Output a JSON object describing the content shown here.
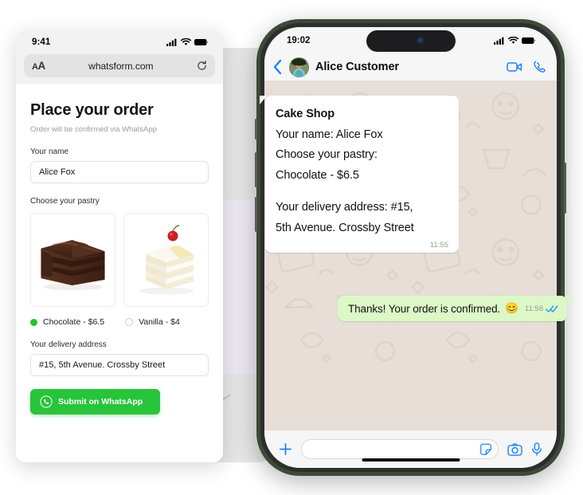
{
  "browser": {
    "status": {
      "time": "9:41",
      "icons": [
        "signal-icon",
        "wifi-icon",
        "battery-icon"
      ]
    },
    "url_bar": {
      "aa_label": "AA",
      "url": "whatsform.com",
      "reload_icon": "reload-icon"
    },
    "form": {
      "title": "Place your order",
      "subtitle": "Order will be confirmed via WhatsApp",
      "name_label": "Your name",
      "name_value": "Alice Fox",
      "name_placeholder": "Your name",
      "pastry_label": "Choose your pastry",
      "pastry_options": [
        {
          "image": "chocolate-cake-image",
          "label": "Chocolate - $6.5",
          "selected": true
        },
        {
          "image": "vanilla-cake-image",
          "label": "Vanilla - $4",
          "selected": false
        }
      ],
      "address_label": "Your delivery address",
      "address_value": "#15, 5th Avenue. Crossby Street",
      "address_placeholder": "Your delivery address",
      "submit_label": "Submit on WhatsApp",
      "submit_icon": "whatsapp-icon",
      "submit_color": "#28c43a"
    }
  },
  "phone": {
    "status": {
      "time": "19:02",
      "icons": [
        "signal-icon",
        "wifi-icon",
        "battery-icon"
      ]
    },
    "header": {
      "back_icon": "back-chevron-icon",
      "avatar": "contact-avatar",
      "contact_name": "Alice Customer",
      "video_icon": "video-call-icon",
      "call_icon": "phone-call-icon"
    },
    "messages": {
      "incoming": {
        "lines": [
          "Cake Shop",
          "Your name: Alice Fox",
          "Choose your pastry:",
          "Chocolate - $6.5",
          "Your delivery address: #15,",
          "5th Avenue. Crossby Street"
        ],
        "time": "11:55"
      },
      "outgoing": {
        "text": "Thanks! Your order is confirmed.",
        "emoji": "😊",
        "time": "11:58",
        "status_icon": "double-check-read-icon"
      }
    },
    "input_bar": {
      "plus_icon": "plus-icon",
      "placeholder": "",
      "sticker_icon": "sticker-icon",
      "camera_icon": "camera-icon",
      "mic_icon": "microphone-icon"
    }
  },
  "colors": {
    "whatsapp_green": "#28c43a",
    "bubble_out": "#dcf8c6",
    "accent_blue": "#1d82f5",
    "phone_bezel": "#3d4a38"
  }
}
